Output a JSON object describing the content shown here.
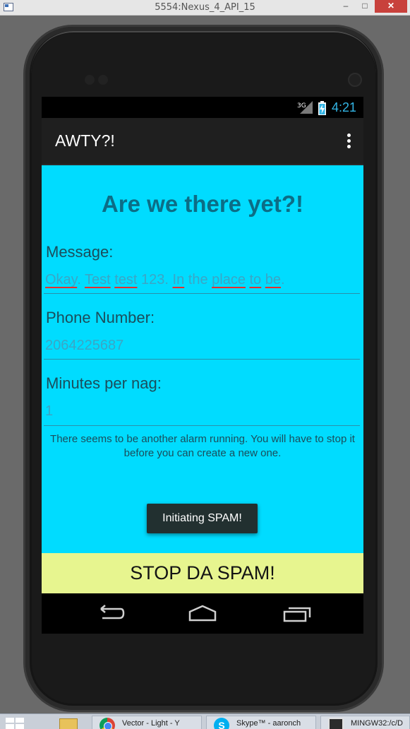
{
  "window": {
    "title": "5554:Nexus_4_API_15",
    "minimize": "–",
    "maximize": "□",
    "close": "✕"
  },
  "status_bar": {
    "network": "3G",
    "time": "4:21"
  },
  "action_bar": {
    "title": "AWTY?!"
  },
  "form": {
    "heading": "Are we there yet?!",
    "message_label": "Message:",
    "message_value_words": [
      "Okay",
      ". ",
      "Test",
      " ",
      "test",
      " 123. ",
      "In",
      " the ",
      "place",
      " ",
      "to",
      " ",
      "be",
      "."
    ],
    "phone_label": "Phone Number:",
    "phone_value": "2064225687",
    "minutes_label": "Minutes per nag:",
    "minutes_value": "1",
    "alarm_note": "There seems to be another alarm running. You will have to stop it before you can create a new one."
  },
  "toast": {
    "text": "Initiating SPAM!"
  },
  "stop_button": {
    "label": "STOP DA SPAM!"
  },
  "nav": {
    "back_icon": "back-icon",
    "home_icon": "home-icon",
    "recent_icon": "recent-apps-icon"
  },
  "taskbar": {
    "items": [
      {
        "label": "Vector - Light - Y",
        "icon": "chrome-icon"
      },
      {
        "label": "Skype™ - aaronch",
        "icon": "skype-icon"
      },
      {
        "label": "MINGW32:/c/D",
        "icon": "terminal-icon"
      }
    ]
  },
  "colors": {
    "content_bg": "#00dcff",
    "heading": "#0c6d86",
    "label": "#1b4d5b",
    "value": "#3aa6c6",
    "stop_button_bg": "#e7f58f",
    "clock": "#33b5e5",
    "toast_bg": "#223030"
  }
}
